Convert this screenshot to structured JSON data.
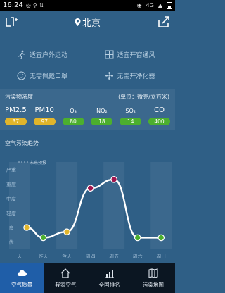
{
  "status_bar": {
    "time": "16:24",
    "signal": "4G"
  },
  "header": {
    "city": "北京"
  },
  "suggestions": [
    {
      "label": "适宜户外运动",
      "icon": "running-icon"
    },
    {
      "label": "适宜开窗通风",
      "icon": "window-icon"
    },
    {
      "label": "无需佩戴口罩",
      "icon": "mask-icon"
    },
    {
      "label": "无需开净化器",
      "icon": "fan-icon"
    }
  ],
  "pollutants": {
    "title": "污染物浓度",
    "unit": "(单位：微克/立方米)",
    "items": [
      {
        "name": "PM2.5",
        "value": "37",
        "color": "#e1b52b"
      },
      {
        "name": "PM10",
        "value": "97",
        "color": "#e1b52b"
      },
      {
        "name": "O₃",
        "value": "80",
        "color": "#4caf2e"
      },
      {
        "name": "NO₂",
        "value": "18",
        "color": "#4caf2e"
      },
      {
        "name": "SO₂",
        "value": "14",
        "color": "#4caf2e"
      },
      {
        "name": "CO",
        "value": "400",
        "color": "#4caf2e"
      }
    ]
  },
  "trend": {
    "title": "空气污染趋势",
    "forecast_label": "未来预报"
  },
  "chart_data": {
    "type": "line",
    "y_labels": [
      "严重",
      "重度",
      "中度",
      "轻度",
      "良",
      "优"
    ],
    "x_labels": [
      "天",
      "昨天",
      "今天",
      "周四",
      "周五",
      "周六",
      "周日"
    ],
    "points": [
      {
        "x": 0.3,
        "y": 1.5,
        "color": "#e1b52b"
      },
      {
        "x": 1.0,
        "y": 0.8,
        "color": "#4caf2e"
      },
      {
        "x": 2.0,
        "y": 1.2,
        "color": "#e1b52b"
      },
      {
        "x": 3.0,
        "y": 4.2,
        "color": "#a0164e"
      },
      {
        "x": 4.0,
        "y": 4.8,
        "color": "#a0164e"
      },
      {
        "x": 5.0,
        "y": 0.8,
        "color": "#4caf2e"
      },
      {
        "x": 6.0,
        "y": 0.8,
        "color": "#4caf2e"
      }
    ],
    "ylim": [
      0,
      6
    ],
    "xlim": [
      0,
      6.5
    ]
  },
  "bottom_nav": [
    {
      "label": "空气质量",
      "icon": "cloud-icon",
      "active": true
    },
    {
      "label": "我家空气",
      "icon": "home-icon",
      "active": false
    },
    {
      "label": "全国排名",
      "icon": "ranking-icon",
      "active": false
    },
    {
      "label": "污染地图",
      "icon": "map-icon",
      "active": false
    }
  ]
}
